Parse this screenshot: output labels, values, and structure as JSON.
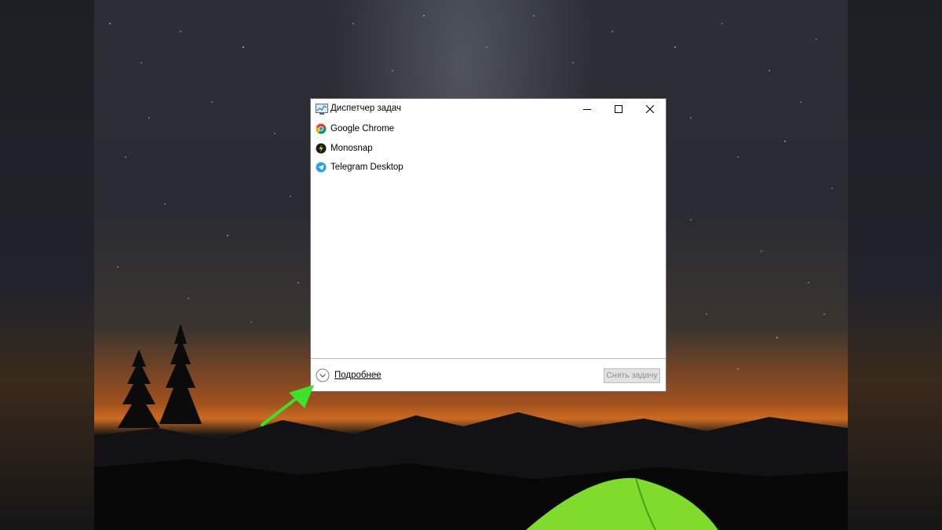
{
  "window": {
    "title": "Диспетчер задач",
    "minimize_icon": "minimize-icon",
    "maximize_icon": "maximize-icon",
    "close_icon": "close-icon"
  },
  "tasks": [
    {
      "label": "Google Chrome",
      "icon": "chrome-icon"
    },
    {
      "label": "Monosnap",
      "icon": "monosnap-icon"
    },
    {
      "label": "Telegram Desktop",
      "icon": "telegram-icon"
    }
  ],
  "footer": {
    "details_label": "Подробнее",
    "details_icon": "chevron-down-circle-icon",
    "end_task_label": "Снять задачу"
  },
  "annotation": {
    "arrow_color": "#3ee02a"
  },
  "colors": {
    "window_bg": "#ffffff",
    "disabled_button_bg": "#e1e1e1",
    "disabled_text": "#8c8c8c"
  }
}
